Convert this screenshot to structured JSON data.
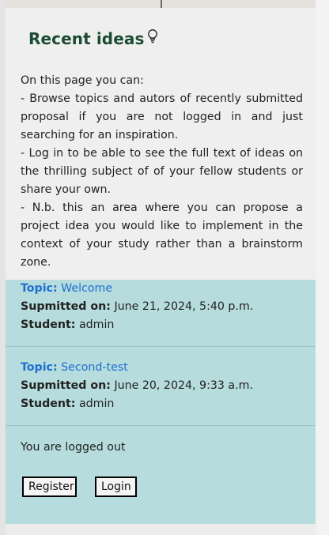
{
  "page": {
    "title": "Recent ideas",
    "title_icon": "lightbulb-icon"
  },
  "intro": [
    "On this page you can:",
    "- Browse topics and autors of recently submitted proposal if you are not logged in and just searching for an inspiration.",
    "- Log in to be able to see the full text of ideas on the thrilling subject of of your fellow students or share your own.",
    "- N.b. this an area where you can propose a project idea you would like to implement in the context of your study rather than a brainstorm zone."
  ],
  "posts": [
    {
      "topic_label": "Topic:",
      "topic": "Welcome",
      "submitted_label": "Supmitted on:",
      "submitted": "June 21, 2024, 5:40 p.m.",
      "student_label": "Student:",
      "student": "admin"
    },
    {
      "topic_label": "Topic:",
      "topic": "Second-test",
      "submitted_label": "Supmitted on:",
      "submitted": "June 20, 2024, 9:33 a.m.",
      "student_label": "Student:",
      "student": "admin"
    }
  ],
  "auth": {
    "status": "You are logged out",
    "register_label": "Register",
    "login_label": "Login"
  },
  "colors": {
    "title": "#1b4b33",
    "link": "#1f6fd1",
    "posts_bg": "#b6dcdd"
  }
}
